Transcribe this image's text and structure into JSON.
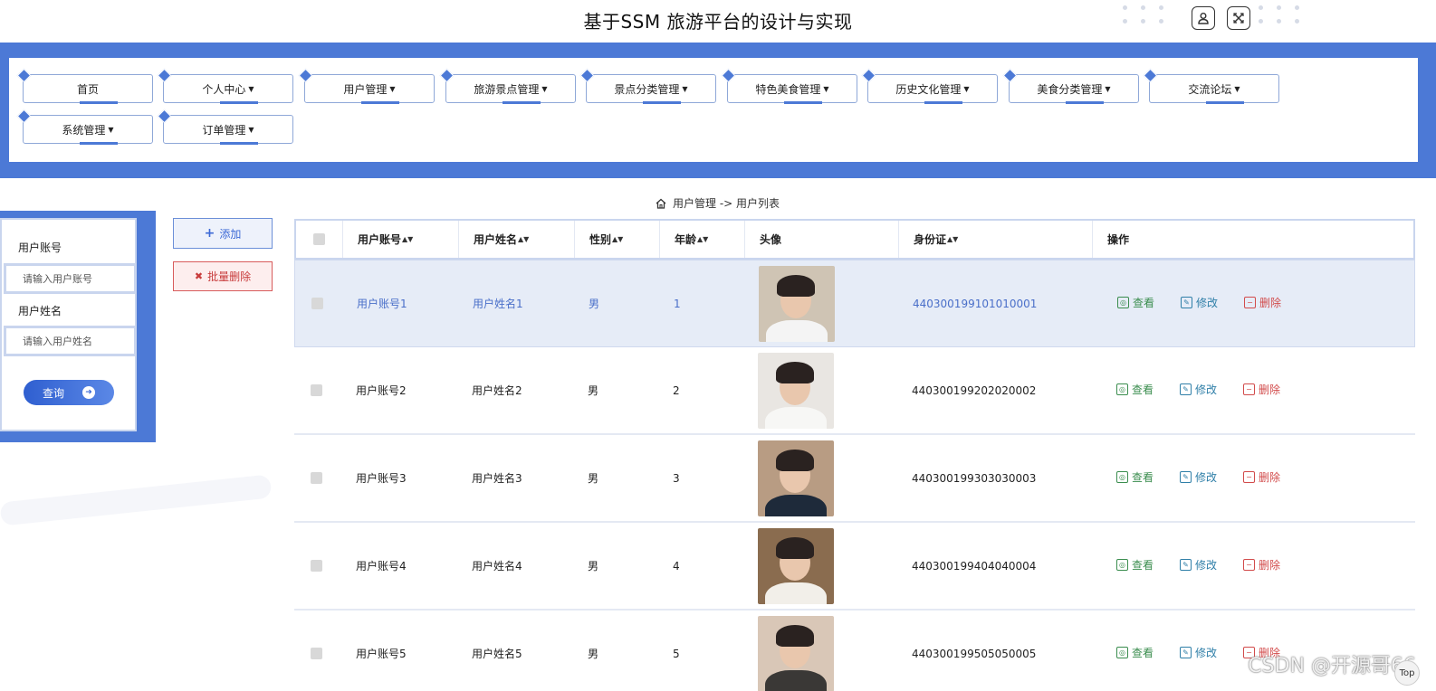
{
  "app": {
    "title": "基于SSM 旅游平台的设计与实现"
  },
  "nav": {
    "items": [
      {
        "label": "首页",
        "dropdown": false
      },
      {
        "label": "个人中心",
        "dropdown": true
      },
      {
        "label": "用户管理",
        "dropdown": true
      },
      {
        "label": "旅游景点管理",
        "dropdown": true
      },
      {
        "label": "景点分类管理",
        "dropdown": true
      },
      {
        "label": "特色美食管理",
        "dropdown": true
      },
      {
        "label": "历史文化管理",
        "dropdown": true
      },
      {
        "label": "美食分类管理",
        "dropdown": true
      },
      {
        "label": "交流论坛",
        "dropdown": true
      },
      {
        "label": "系统管理",
        "dropdown": true
      },
      {
        "label": "订单管理",
        "dropdown": true
      }
    ]
  },
  "breadcrumb": {
    "text": "用户管理 -> 用户列表"
  },
  "search": {
    "account_label": "用户账号",
    "account_placeholder": "请输入用户账号",
    "name_label": "用户姓名",
    "name_placeholder": "请输入用户姓名",
    "query_label": "查询"
  },
  "actions": {
    "add_label": "添加",
    "batch_delete_label": "批量删除"
  },
  "table": {
    "headers": {
      "account": "用户账号",
      "name": "用户姓名",
      "gender": "性别",
      "age": "年龄",
      "avatar": "头像",
      "id_card": "身份证",
      "ops": "操作"
    },
    "ops": {
      "view": "查看",
      "edit": "修改",
      "delete": "删除"
    },
    "rows": [
      {
        "account": "用户账号1",
        "name": "用户姓名1",
        "gender": "男",
        "age": "1",
        "id_card": "440300199101010001"
      },
      {
        "account": "用户账号2",
        "name": "用户姓名2",
        "gender": "男",
        "age": "2",
        "id_card": "440300199202020002"
      },
      {
        "account": "用户账号3",
        "name": "用户姓名3",
        "gender": "男",
        "age": "3",
        "id_card": "440300199303030003"
      },
      {
        "account": "用户账号4",
        "name": "用户姓名4",
        "gender": "男",
        "age": "4",
        "id_card": "440300199404040004"
      },
      {
        "account": "用户账号5",
        "name": "用户姓名5",
        "gender": "男",
        "age": "5",
        "id_card": "440300199505050005"
      }
    ]
  },
  "watermark": "CSDN @开源哥66",
  "back_to_top": "Top",
  "colors": {
    "accent": "#4c79d6",
    "view": "#3a8d4e",
    "edit": "#2f7fa8",
    "delete": "#d24b4b"
  }
}
